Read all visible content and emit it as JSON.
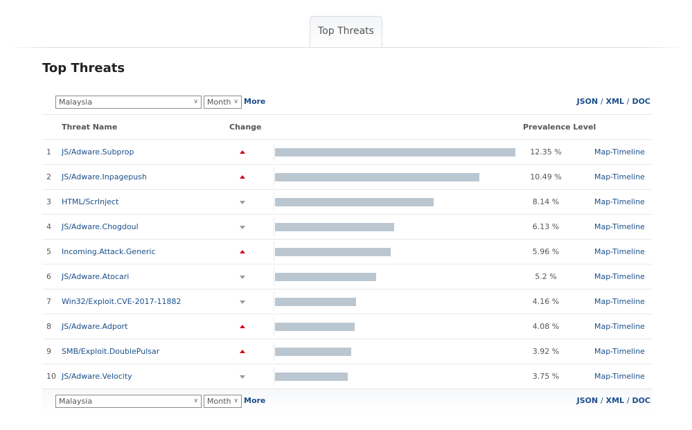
{
  "tabs": [
    {
      "label": "Top Threats",
      "active": true
    }
  ],
  "page_title": "Top Threats",
  "controls": {
    "country": "Malaysia",
    "period": "Month",
    "more": "More",
    "exports": [
      "JSON",
      "XML",
      "DOC"
    ],
    "separator": "/"
  },
  "table": {
    "headers": {
      "name": "Threat Name",
      "change": "Change",
      "prevalence": "Prevalence Level"
    },
    "max_scale_percent": 12.35,
    "rows": [
      {
        "rank": "1",
        "name": "JS/Adware.Subprop",
        "change": "up",
        "prevalence": 12.35,
        "prevalence_text": "12.35 %",
        "link": "Map-Timeline"
      },
      {
        "rank": "2",
        "name": "JS/Adware.Inpagepush",
        "change": "up",
        "prevalence": 10.49,
        "prevalence_text": "10.49 %",
        "link": "Map-Timeline"
      },
      {
        "rank": "3",
        "name": "HTML/ScrInject",
        "change": "down",
        "prevalence": 8.14,
        "prevalence_text": "8.14 %",
        "link": "Map-Timeline"
      },
      {
        "rank": "4",
        "name": "JS/Adware.Chogdoul",
        "change": "down",
        "prevalence": 6.13,
        "prevalence_text": "6.13 %",
        "link": "Map-Timeline"
      },
      {
        "rank": "5",
        "name": "Incoming.Attack.Generic",
        "change": "up",
        "prevalence": 5.96,
        "prevalence_text": "5.96 %",
        "link": "Map-Timeline"
      },
      {
        "rank": "6",
        "name": "JS/Adware.Atocari",
        "change": "down",
        "prevalence": 5.2,
        "prevalence_text": "5.2 %",
        "link": "Map-Timeline"
      },
      {
        "rank": "7",
        "name": "Win32/Exploit.CVE-2017-11882",
        "change": "down",
        "prevalence": 4.16,
        "prevalence_text": "4.16 %",
        "link": "Map-Timeline"
      },
      {
        "rank": "8",
        "name": "JS/Adware.Adport",
        "change": "up",
        "prevalence": 4.08,
        "prevalence_text": "4.08 %",
        "link": "Map-Timeline"
      },
      {
        "rank": "9",
        "name": "SMB/Exploit.DoublePulsar",
        "change": "up",
        "prevalence": 3.92,
        "prevalence_text": "3.92 %",
        "link": "Map-Timeline"
      },
      {
        "rank": "10",
        "name": "JS/Adware.Velocity",
        "change": "down",
        "prevalence": 3.75,
        "prevalence_text": "3.75 %",
        "link": "Map-Timeline"
      }
    ]
  },
  "colors": {
    "link": "#1a4e8a",
    "up": "#d0021b",
    "down": "#999999",
    "bar": "#bac6d0"
  }
}
